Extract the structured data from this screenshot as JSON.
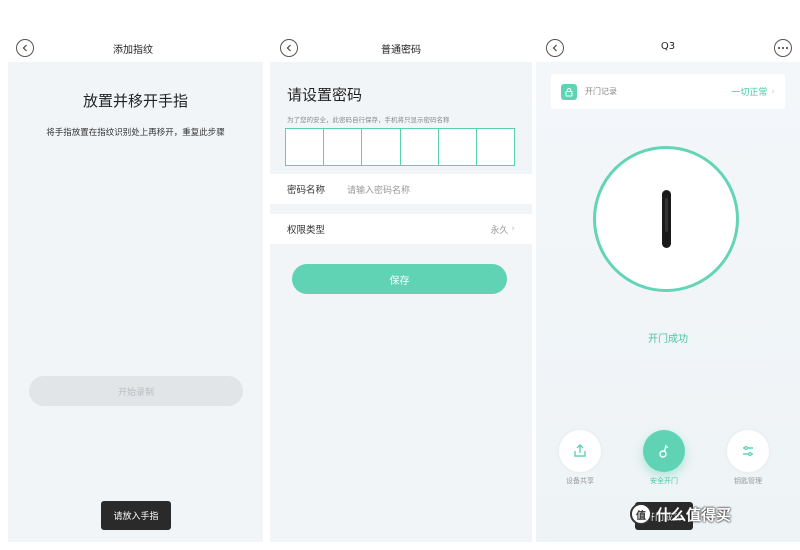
{
  "screen1": {
    "title": "添加指纹",
    "heading": "放置并移开手指",
    "instruction": "将手指放置在指纹识别处上再移开，重复此步骤",
    "start_button": "开始录制",
    "toast": "请放入手指"
  },
  "screen2": {
    "title": "普通密码",
    "heading": "请设置密码",
    "hint": "为了您的安全，此密码自行保存，手机将只显示密码名称",
    "pin_length": 6,
    "name_label": "密码名称",
    "name_placeholder": "请输入密码名称",
    "permission_label": "权限类型",
    "permission_value": "永久",
    "save_button": "保存"
  },
  "screen3": {
    "title": "Q3",
    "log_label": "开门记录",
    "log_status": "一切正常",
    "result": "开门成功",
    "share_label": "设备共享",
    "unlock_label": "安全开门",
    "key_label": "钥匙管理",
    "toast": "开门成功"
  },
  "watermark": {
    "badge": "值",
    "text": "什么值得买"
  },
  "colors": {
    "accent": "#5fd3b4",
    "accent_text": "#48c6a3",
    "background": "#f2f5f8"
  }
}
